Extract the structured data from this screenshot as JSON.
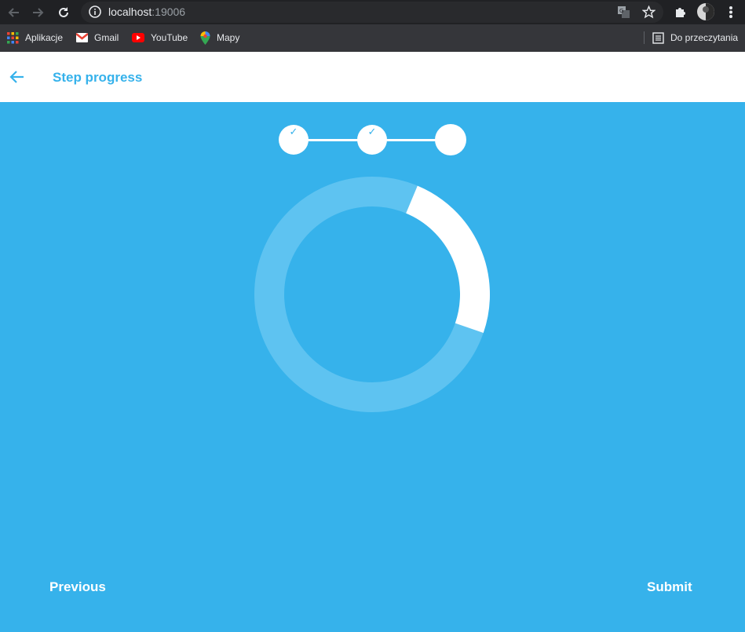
{
  "browser": {
    "url_host": "localhost",
    "url_port": ":19006",
    "bookmarks": [
      {
        "label": "Aplikacje",
        "icon": "apps-grid-icon"
      },
      {
        "label": "Gmail",
        "icon": "gmail-icon"
      },
      {
        "label": "YouTube",
        "icon": "youtube-icon"
      },
      {
        "label": "Mapy",
        "icon": "maps-pin-icon"
      }
    ],
    "reading_list": "Do przeczytania"
  },
  "appbar": {
    "title": "Step progress",
    "back_icon": "arrow-left-icon"
  },
  "stepper": {
    "steps": [
      {
        "completed": true,
        "mark": "✓"
      },
      {
        "completed": true,
        "mark": "✓"
      },
      {
        "completed": false,
        "mark": ""
      }
    ]
  },
  "progress_ring": {
    "progress_start_fraction": 0.063,
    "progress_end_fraction": 0.303,
    "track_color": "#5ec3f1",
    "progress_color": "#ffffff"
  },
  "footer": {
    "previous_label": "Previous",
    "submit_label": "Submit"
  },
  "colors": {
    "accent": "#36b2eb",
    "background": "#36b2eb"
  }
}
